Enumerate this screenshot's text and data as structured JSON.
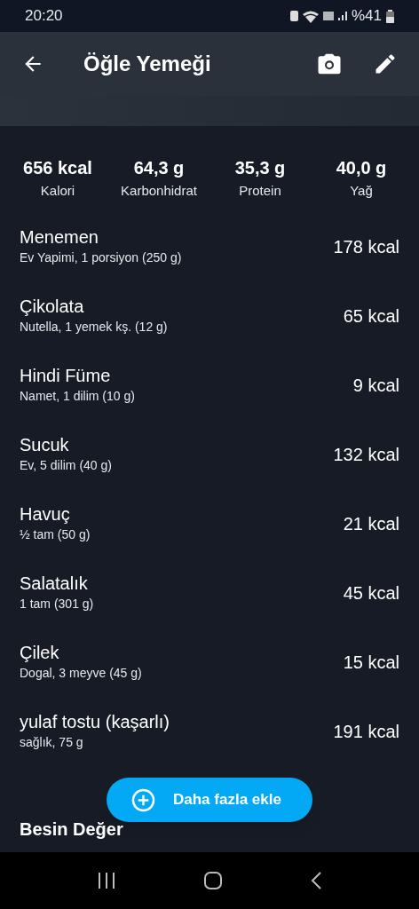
{
  "status_bar": {
    "time": "20:20",
    "battery": "%41"
  },
  "header": {
    "title": "Öğle Yemeği"
  },
  "summary": [
    {
      "value": "656 kcal",
      "label": "Kalori"
    },
    {
      "value": "64,3 g",
      "label": "Karbonhidrat"
    },
    {
      "value": "35,3 g",
      "label": "Protein"
    },
    {
      "value": "40,0 g",
      "label": "Yağ"
    }
  ],
  "foods": [
    {
      "name": "Menemen",
      "detail": "Ev Yapimi, 1 porsiyon (250 g)",
      "calories": "178 kcal"
    },
    {
      "name": "Çikolata",
      "detail": "Nutella, 1 yemek kş. (12 g)",
      "calories": "65 kcal"
    },
    {
      "name": "Hindi Füme",
      "detail": "Namet, 1 dilim (10 g)",
      "calories": "9 kcal"
    },
    {
      "name": "Sucuk",
      "detail": "Ev, 5 dilim (40 g)",
      "calories": "132 kcal"
    },
    {
      "name": "Havuç",
      "detail": "½ tam (50 g)",
      "calories": "21 kcal"
    },
    {
      "name": "Salatalık",
      "detail": "1 tam (301 g)",
      "calories": "45 kcal"
    },
    {
      "name": "Çilek",
      "detail": "Dogal, 3 meyve (45 g)",
      "calories": "15 kcal"
    },
    {
      "name": "yulaf tostu (kaşarlı)",
      "detail": "sağlık, 75 g",
      "calories": "191 kcal"
    }
  ],
  "section_heading": "Besin Değer",
  "add_button": {
    "label": "Daha fazla ekle"
  }
}
